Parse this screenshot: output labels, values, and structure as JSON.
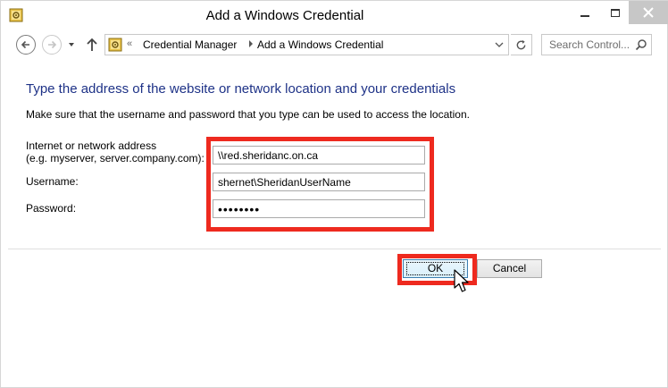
{
  "window": {
    "title": "Add a Windows Credential",
    "app_icon": "credential-manager-icon"
  },
  "navigation": {
    "address_chevron": "«",
    "breadcrumbs": [
      "Credential Manager",
      "Add a Windows Credential"
    ],
    "search_placeholder": "Search Control..."
  },
  "form": {
    "heading": "Type the address of the website or network location and your credentials",
    "description": "Make sure that the username and password that you type can be used to access the location.",
    "address_label_line1": "Internet or network address",
    "address_label_line2": "(e.g. myserver, server.company.com):",
    "address_value": "\\\\red.sheridanc.on.ca",
    "username_label": "Username:",
    "username_value": "shernet\\SheridanUserName",
    "password_label": "Password:",
    "password_value": "••••••••"
  },
  "buttons": {
    "ok_label": "OK",
    "cancel_label": "Cancel"
  },
  "colors": {
    "heading": "#1e3287",
    "highlight": "#ee2a1f"
  }
}
